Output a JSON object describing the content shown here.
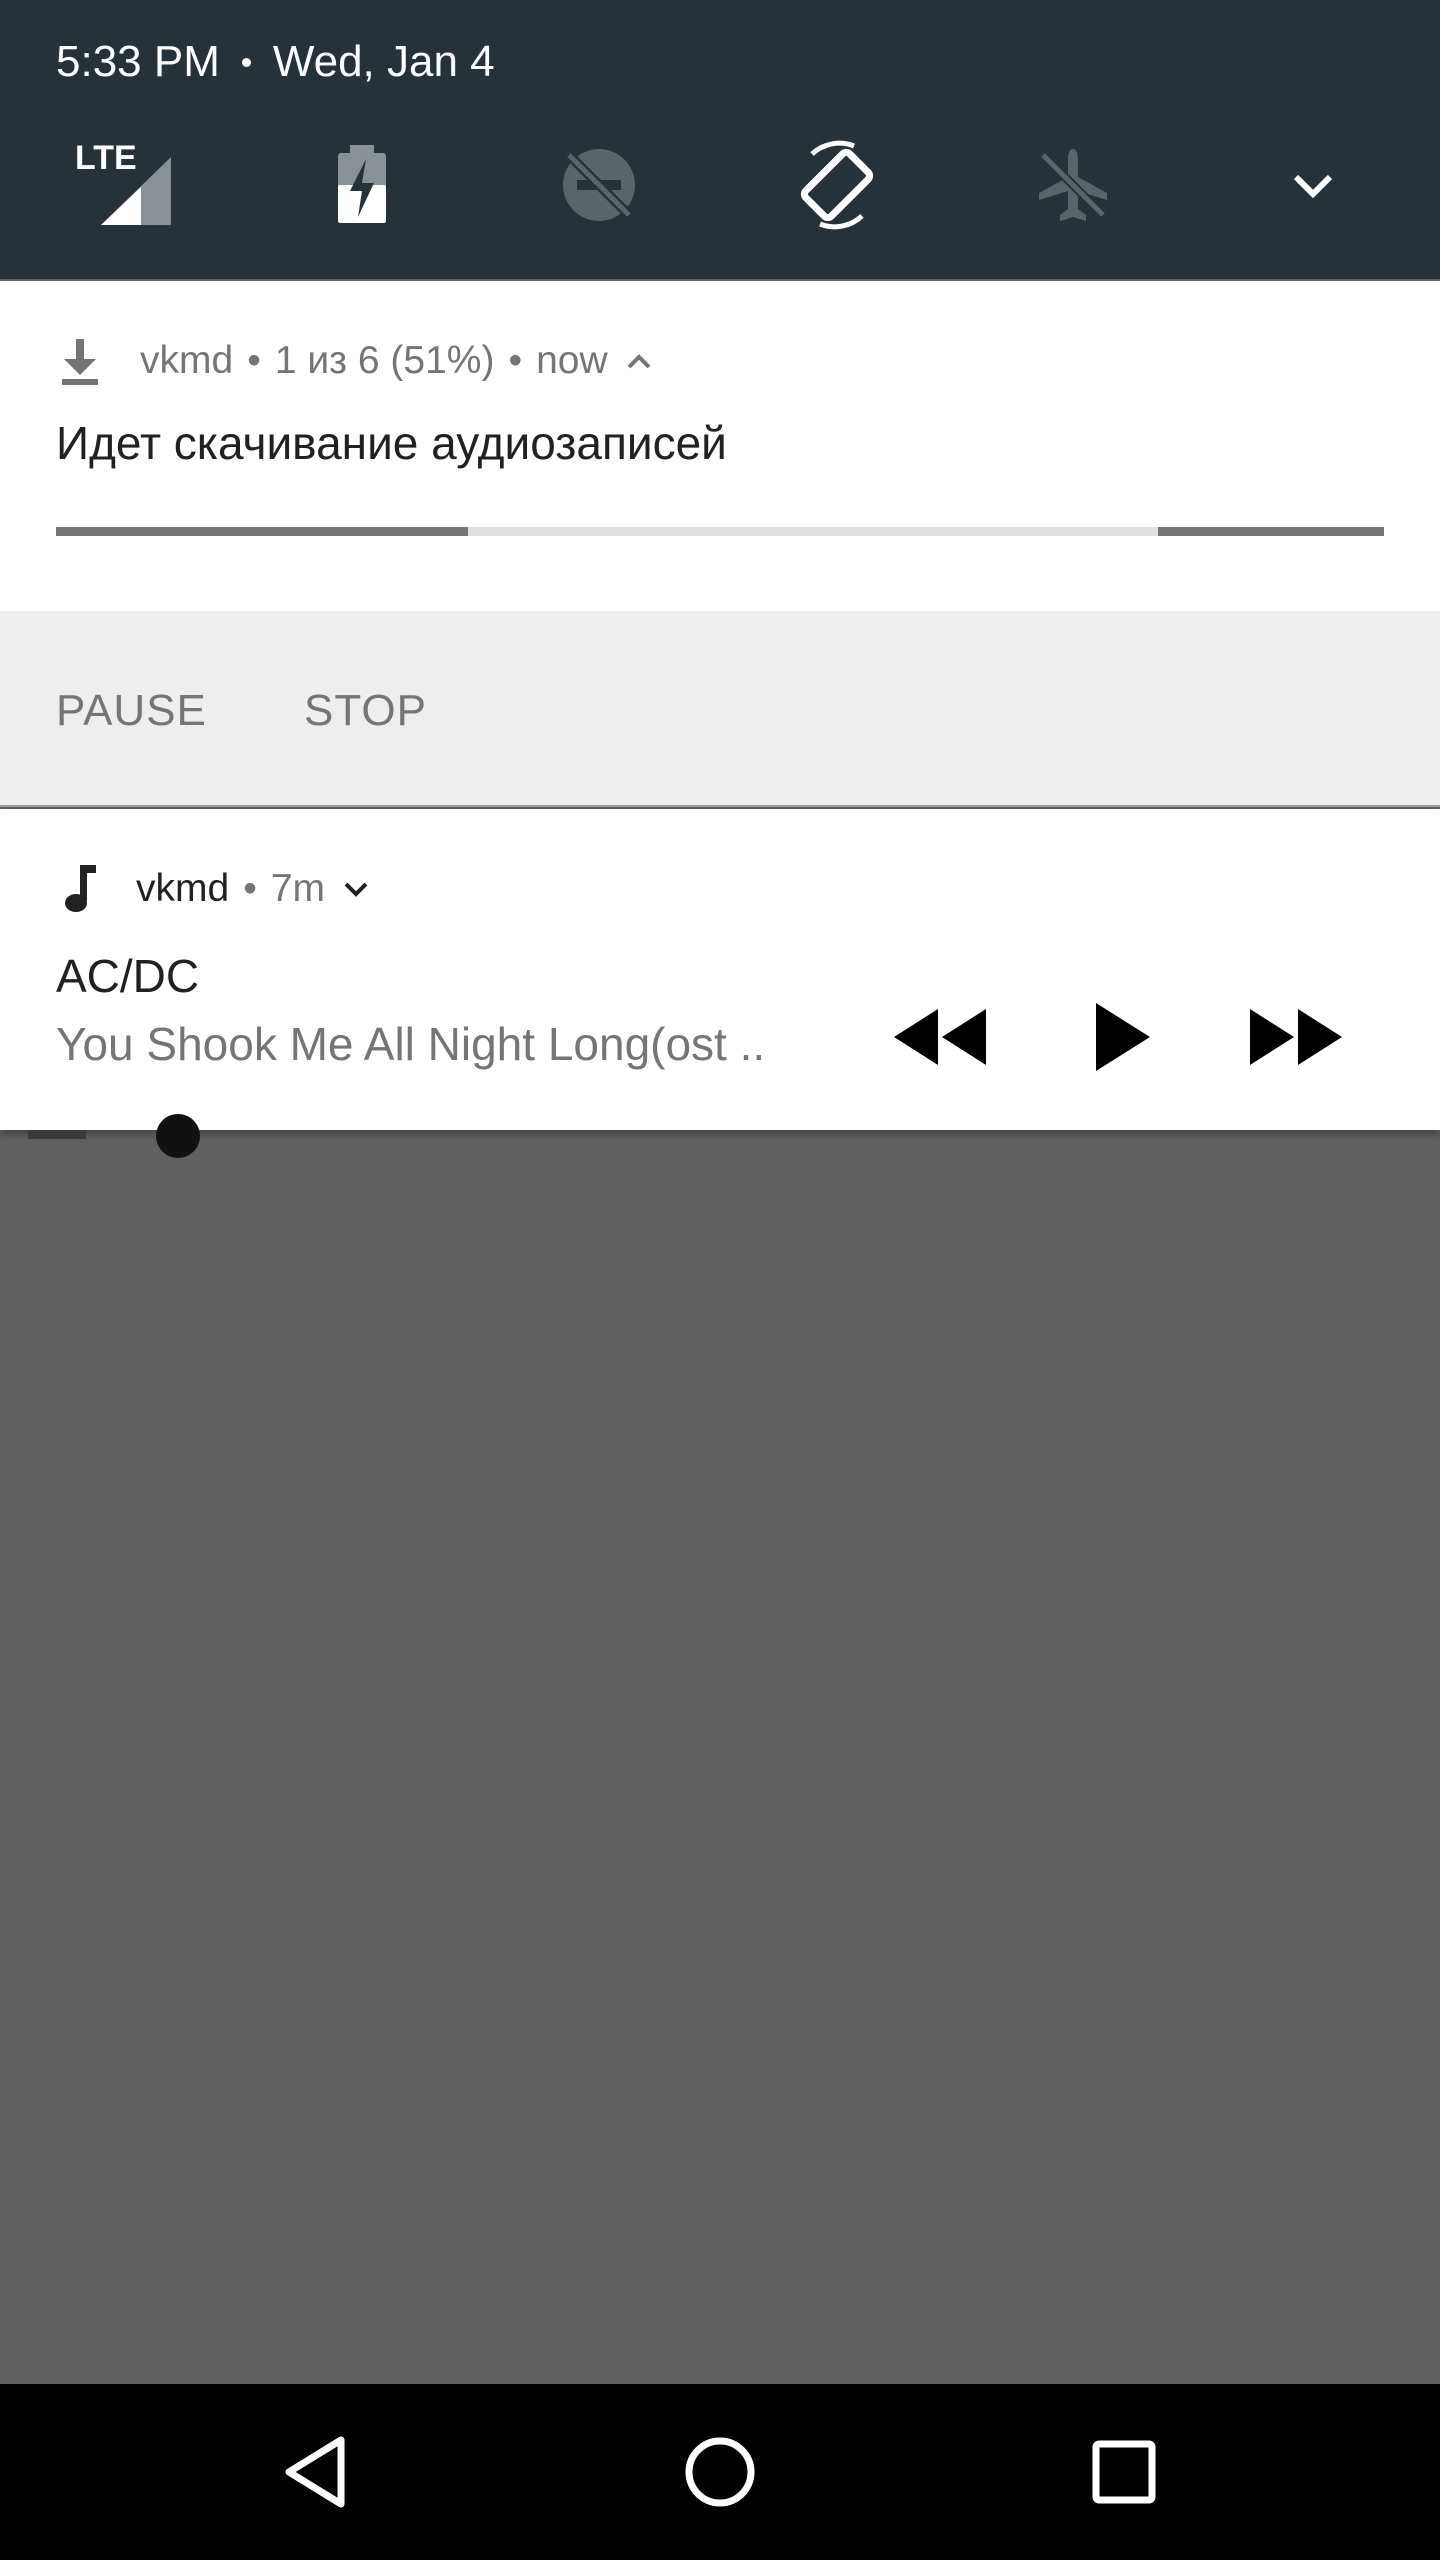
{
  "status": {
    "time": "5:33 PM",
    "date": "Wed, Jan 4"
  },
  "quick_settings": {
    "tiles": [
      {
        "name": "lte-signal-icon",
        "label": "LTE"
      },
      {
        "name": "battery-charging-icon"
      },
      {
        "name": "do-not-disturb-off-icon"
      },
      {
        "name": "auto-rotate-icon"
      },
      {
        "name": "airplane-mode-off-icon"
      },
      {
        "name": "expand-chevron-icon"
      }
    ]
  },
  "download_notification": {
    "app": "vkmd",
    "progress_text": "1 из 6 (51%)",
    "time": "now",
    "title": "Идет скачивание аудиозаписей",
    "progress": 0.31,
    "buffer": 0.17,
    "actions": {
      "pause": "PAUSE",
      "stop": "STOP"
    }
  },
  "media_notification": {
    "app": "vkmd",
    "time": "7m",
    "artist": "AC/DC",
    "track": "You Shook Me All Night Long(ost ..",
    "controls": [
      "rewind-icon",
      "play-icon",
      "fast-forward-icon"
    ]
  },
  "colors": {
    "header_bg": "#263238",
    "scrim": "#616161",
    "progress": "#757575"
  }
}
